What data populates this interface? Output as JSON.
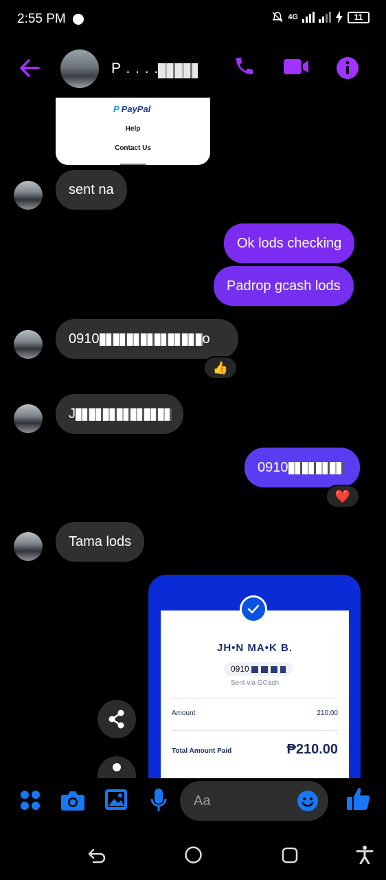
{
  "status_bar": {
    "time": "2:55 PM",
    "network": "4G",
    "battery": "11"
  },
  "header": {
    "contact_name": "P . . . ."
  },
  "messages": {
    "paypal_card": {
      "brand": "PayPal",
      "help": "Help",
      "contact": "Contact Us"
    },
    "m1": "sent na",
    "m2": "Ok lods checking",
    "m3": "Padrop gcash lods",
    "m4_prefix": "0910",
    "m4_suffix": "o",
    "m4_reaction": "👍",
    "m5_prefix": "J",
    "m6_prefix": "0910",
    "m6_reaction": "❤️",
    "m7": "Tama lods"
  },
  "gcash_receipt": {
    "recipient": "JH•N MA•K B.",
    "number_prefix": "0910",
    "sent_via": "Sent via GCash",
    "amount_label": "Amount",
    "amount_value": "210.00",
    "total_label": "Total Amount Paid",
    "total_value": "₱210.00"
  },
  "composer": {
    "placeholder": "Aa"
  },
  "colors": {
    "accent": "#a033ff",
    "outgoing": "#7b2cf0",
    "messenger_blue": "#1877f2",
    "gcash_blue": "#0a2bd6"
  }
}
